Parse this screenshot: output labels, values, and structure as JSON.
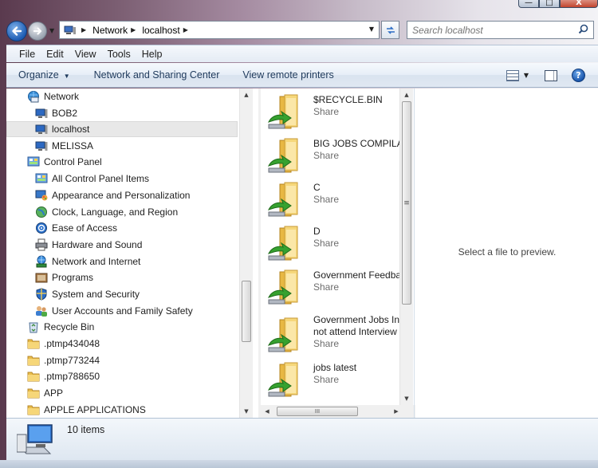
{
  "window": {
    "buttons": {
      "minimize": "—",
      "maximize": "□",
      "close": "X"
    }
  },
  "address": {
    "crumbs": [
      "Network",
      "localhost"
    ]
  },
  "search": {
    "placeholder": "Search localhost"
  },
  "menu": [
    "File",
    "Edit",
    "View",
    "Tools",
    "Help"
  ],
  "commands": {
    "organize": "Organize",
    "network_center": "Network and Sharing Center",
    "view_printers": "View remote printers",
    "help": "?"
  },
  "nav": {
    "network": "Network",
    "bob2": "BOB2",
    "localhost": "localhost",
    "melissa": "MELISSA",
    "control_panel": "Control Panel",
    "cp_all": "All Control Panel Items",
    "cp_appearance": "Appearance and Personalization",
    "cp_clock": "Clock, Language, and Region",
    "cp_ease": "Ease of Access",
    "cp_hardware": "Hardware and Sound",
    "cp_network": "Network and Internet",
    "cp_programs": "Programs",
    "cp_system": "System and Security",
    "cp_users": "User Accounts and Family Safety",
    "recycle": "Recycle Bin",
    "ptmp1": ".ptmp434048",
    "ptmp2": ".ptmp773244",
    "ptmp3": ".ptmp788650",
    "app": "APP",
    "apple_apps": "APPLE APPLICATIONS"
  },
  "files": [
    {
      "name": "$RECYCLE.BIN",
      "sub": "Share"
    },
    {
      "name": "BIG JOBS COMPILATION",
      "sub": "Share"
    },
    {
      "name": "C",
      "sub": "Share"
    },
    {
      "name": "D",
      "sub": "Share"
    },
    {
      "name": "Government Feedback",
      "sub": "Share"
    },
    {
      "name": "Government Jobs Interview",
      "name2": "not attend Interview",
      "sub": "Share"
    },
    {
      "name": "jobs latest",
      "sub": "Share"
    }
  ],
  "preview": {
    "message": "Select a file to preview."
  },
  "details": {
    "count": "10 items"
  },
  "scroll": {
    "hthumb_grip": "III",
    "vthumb_grip": "≡"
  },
  "colors": {
    "accent": "#1e395b",
    "folder": "#f3d46b",
    "share_arrow": "#3aa233"
  }
}
